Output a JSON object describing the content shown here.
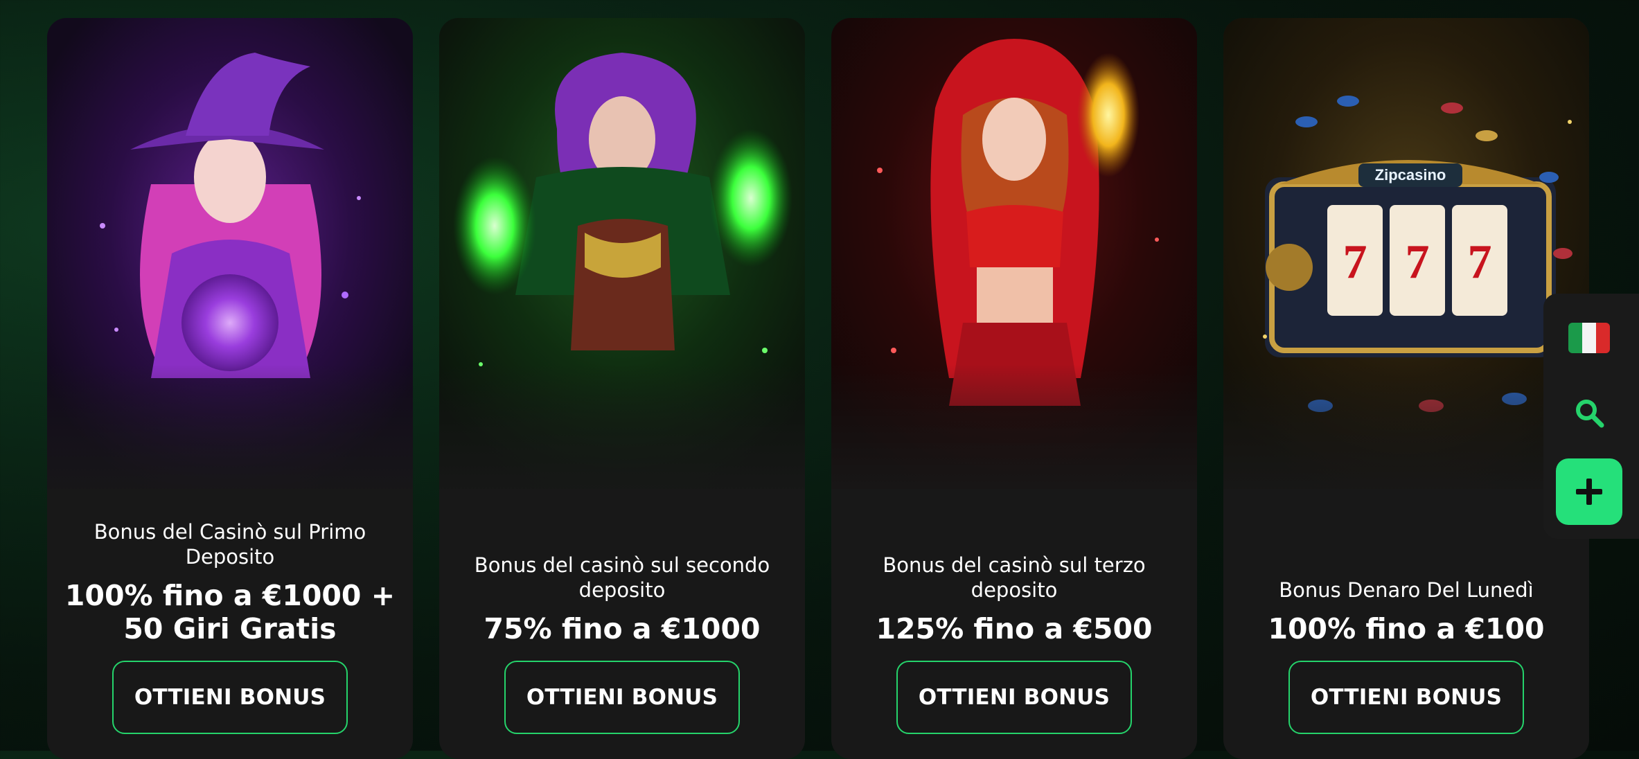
{
  "colors": {
    "accent": "#25d36b",
    "card_bg": "#181818",
    "page_bg": "#07150d",
    "text": "#ffffff"
  },
  "cards": [
    {
      "subtitle": "Bonus del Casinò sul Primo Deposito",
      "amount": "100% fino a €1000 + 50 Giri Gratis",
      "button": "OTTIENI BONUS",
      "image": "purple-witch-illustration"
    },
    {
      "subtitle": "Bonus del casinò sul secondo deposito",
      "amount": "75% fino a €1000",
      "button": "OTTIENI BONUS",
      "image": "green-sorceress-illustration"
    },
    {
      "subtitle": "Bonus del casinò sul terzo deposito",
      "amount": "125% fino a €500",
      "button": "OTTIENI BONUS",
      "image": "red-hood-sorceress-illustration"
    },
    {
      "subtitle": "Bonus Denaro Del Lunedì",
      "amount": "100% fino a €100",
      "button": "OTTIENI BONUS",
      "image": "slot-machine-illustration",
      "slot_machine": {
        "logo_text": "Zipcasino",
        "reels": [
          "7",
          "7",
          "7"
        ]
      }
    }
  ],
  "side_panel": {
    "language_flag": "italy-flag-icon",
    "search": "search-icon",
    "add": "plus-icon"
  }
}
